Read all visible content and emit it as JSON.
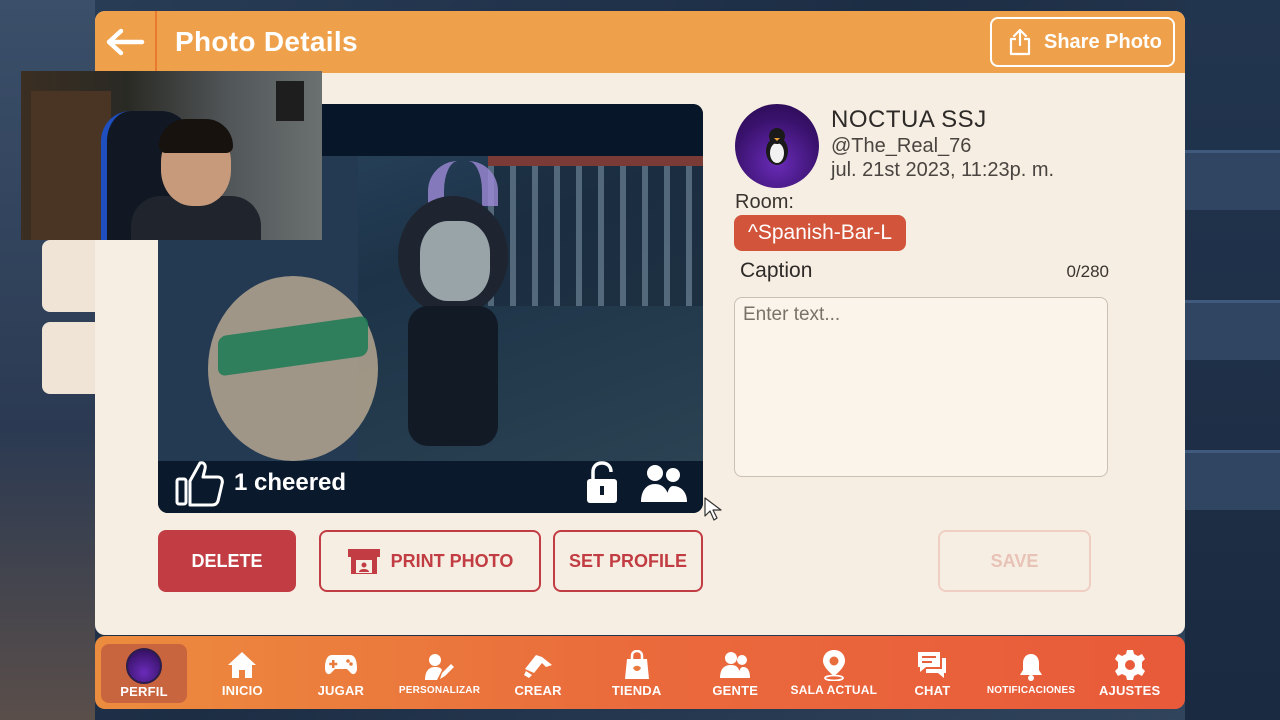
{
  "header": {
    "title": "Photo Details",
    "share_label": "Share Photo"
  },
  "photo": {
    "cheer_text": "1 cheered"
  },
  "profile": {
    "display_name": "NOCTUA SSJ",
    "username": "@The_Real_76",
    "timestamp": "jul. 21st 2023, 11:23p. m.",
    "room_label": "Room:",
    "room_name": "^Spanish-Bar-L"
  },
  "caption": {
    "label": "Caption",
    "count": "0/280",
    "placeholder": "Enter text...",
    "value": ""
  },
  "actions": {
    "delete": "DELETE",
    "print": "PRINT PHOTO",
    "set_profile": "SET PROFILE",
    "save": "SAVE"
  },
  "nav": {
    "items": [
      {
        "label": "PERFIL",
        "icon": "avatar"
      },
      {
        "label": "INICIO",
        "icon": "home-icon"
      },
      {
        "label": "JUGAR",
        "icon": "gamepad-icon"
      },
      {
        "label": "PERSONALIZAR",
        "icon": "customize-icon"
      },
      {
        "label": "CREAR",
        "icon": "create-icon"
      },
      {
        "label": "TIENDA",
        "icon": "shop-icon"
      },
      {
        "label": "GENTE",
        "icon": "people-icon"
      },
      {
        "label": "SALA ACTUAL",
        "icon": "location-icon"
      },
      {
        "label": "CHAT",
        "icon": "chat-icon"
      },
      {
        "label": "NOTIFICACIONES",
        "icon": "bell-icon"
      },
      {
        "label": "AJUSTES",
        "icon": "gear-icon"
      }
    ]
  },
  "colors": {
    "header": "#eea04a",
    "panel": "#f6eee2",
    "accent_red": "#c23d43",
    "room_chip": "#d2543a",
    "nav_start": "#ec8c3e",
    "nav_end": "#e85a3a"
  }
}
